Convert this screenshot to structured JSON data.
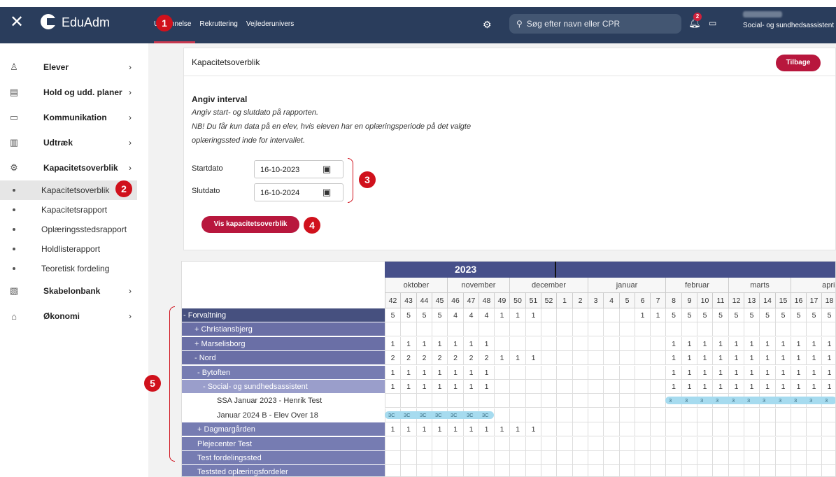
{
  "app": {
    "name": "EduAdm"
  },
  "topnav": {
    "tabs": [
      "Uddannelse",
      "Rekruttering",
      "Vejlederunivers"
    ],
    "active_tab": "Uddannelse",
    "search_placeholder": "Søg efter navn eller CPR",
    "notification_count": "2",
    "user_role": "Social- og sundhedsassistent"
  },
  "sidebar": {
    "items": [
      {
        "label": "Elever",
        "icon": "person-icon"
      },
      {
        "label": "Hold og udd. planer",
        "icon": "calendar-list-icon"
      },
      {
        "label": "Kommunikation",
        "icon": "chat-icon"
      },
      {
        "label": "Udtræk",
        "icon": "document-icon"
      },
      {
        "label": "Kapacitetsoverblik",
        "icon": "gear-icon"
      }
    ],
    "subitems": [
      "Kapacitetsoverblik",
      "Kapacitetsrapport",
      "Oplæringsstedsrapport",
      "Holdlisterapport",
      "Teoretisk fordeling"
    ],
    "active_subitem": "Kapacitetsoverblik",
    "items_after": [
      {
        "label": "Skabelonbank",
        "icon": "template-icon"
      },
      {
        "label": "Økonomi",
        "icon": "bag-icon"
      }
    ]
  },
  "annotations": [
    "1",
    "2",
    "3",
    "4",
    "5"
  ],
  "card": {
    "title": "Kapacitetsoverblik",
    "back_label": "Tilbage",
    "interval_title": "Angiv interval",
    "interval_lines": [
      "Angiv start- og slutdato på rapporten.",
      "NB! Du får kun data på en elev, hvis eleven har en oplæringsperiode på det valgte",
      "oplæringssted inde for intervallet."
    ],
    "start_label": "Startdato",
    "start_value": "16-10-2023",
    "end_label": "Slutdato",
    "end_value": "16-10-2024",
    "submit_label": "Vis kapacitetsoverblik"
  },
  "grid": {
    "year": "2023",
    "months": [
      {
        "label": "oktober",
        "weeks": 4
      },
      {
        "label": "november",
        "weeks": 4
      },
      {
        "label": "december",
        "weeks": 5
      },
      {
        "label": "januar",
        "weeks": 5
      },
      {
        "label": "februar",
        "weeks": 4
      },
      {
        "label": "marts",
        "weeks": 4
      },
      {
        "label": "april",
        "weeks": 5
      }
    ],
    "weeks": [
      "42",
      "43",
      "44",
      "45",
      "46",
      "47",
      "48",
      "49",
      "50",
      "51",
      "52",
      "1",
      "2",
      "3",
      "4",
      "5",
      "6",
      "7",
      "8",
      "9",
      "10",
      "11",
      "12",
      "13",
      "14",
      "15",
      "16",
      "17",
      "18"
    ],
    "rows": [
      {
        "label": "- Forvaltning",
        "level": 0,
        "values": [
          "5",
          "5",
          "5",
          "5",
          "4",
          "4",
          "4",
          "1",
          "1",
          "1",
          "",
          "",
          "",
          "",
          "",
          "",
          "1",
          "1",
          "5",
          "5",
          "5",
          "5",
          "5",
          "5",
          "5",
          "5",
          "5",
          "5",
          "5"
        ]
      },
      {
        "label": "+ Christiansbjerg",
        "level": 1,
        "values": []
      },
      {
        "label": "+ Marselisborg",
        "level": 1,
        "values": [
          "1",
          "1",
          "1",
          "1",
          "1",
          "1",
          "1",
          "",
          "",
          "",
          "",
          "",
          "",
          "",
          "",
          "",
          "",
          "",
          "1",
          "1",
          "1",
          "1",
          "1",
          "1",
          "1",
          "1",
          "1",
          "1",
          "1"
        ]
      },
      {
        "label": "- Nord",
        "level": 1,
        "values": [
          "2",
          "2",
          "2",
          "2",
          "2",
          "2",
          "2",
          "1",
          "1",
          "1",
          "",
          "",
          "",
          "",
          "",
          "",
          "",
          "",
          "1",
          "1",
          "1",
          "1",
          "1",
          "1",
          "1",
          "1",
          "1",
          "1",
          "1"
        ]
      },
      {
        "label": "- Bytoften",
        "level": 2,
        "values": [
          "1",
          "1",
          "1",
          "1",
          "1",
          "1",
          "1",
          "",
          "",
          "",
          "",
          "",
          "",
          "",
          "",
          "",
          "",
          "",
          "1",
          "1",
          "1",
          "1",
          "1",
          "1",
          "1",
          "1",
          "1",
          "1",
          "1"
        ]
      },
      {
        "label": "- Social- og sundhedsassistent",
        "level": 3,
        "values": [
          "1",
          "1",
          "1",
          "1",
          "1",
          "1",
          "1",
          "",
          "",
          "",
          "",
          "",
          "",
          "",
          "",
          "",
          "",
          "",
          "1",
          "1",
          "1",
          "1",
          "1",
          "1",
          "1",
          "1",
          "1",
          "1",
          "1"
        ]
      },
      {
        "label": "SSA Januar 2023 - Henrik Test",
        "level": 4,
        "pill": {
          "start": 18,
          "end": 28,
          "text": "3"
        },
        "values": []
      },
      {
        "label": "Januar 2024 B - Elev Over 18",
        "level": 4,
        "pill": {
          "start": 0,
          "end": 6,
          "text": "3C"
        },
        "values": []
      },
      {
        "label": "+ Dagmargården",
        "level": 2,
        "values": [
          "1",
          "1",
          "1",
          "1",
          "1",
          "1",
          "1",
          "1",
          "1",
          "1"
        ]
      },
      {
        "label": "Plejecenter Test",
        "level": 2,
        "values": []
      },
      {
        "label": "Test fordelingssted",
        "level": 2,
        "values": []
      },
      {
        "label": "Teststed oplæringsfordeler",
        "level": 2,
        "values": []
      }
    ]
  }
}
